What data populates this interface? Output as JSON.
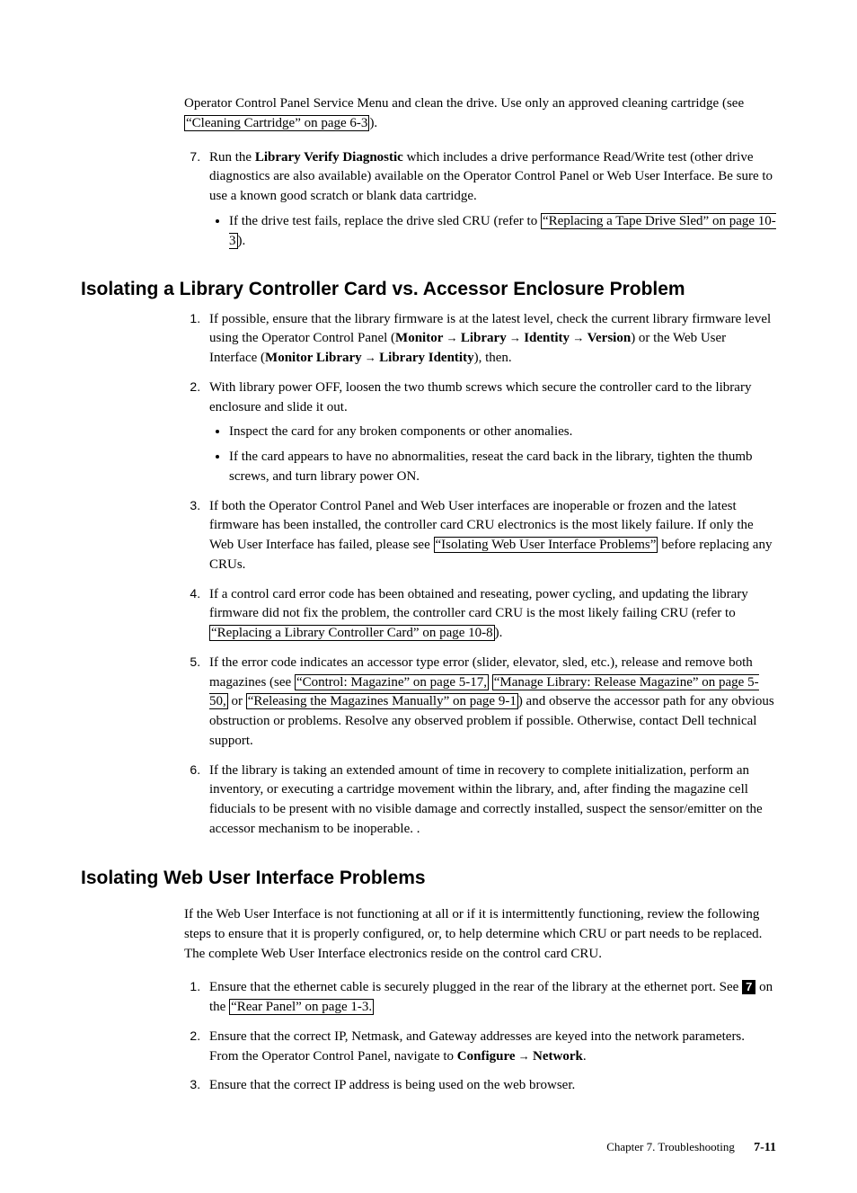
{
  "preamble": {
    "para": "Operator Control Panel Service Menu and clean the drive. Use only an approved cleaning cartridge (see ",
    "link": "“Cleaning Cartridge” on page 6-3",
    "tail": ")."
  },
  "topList": {
    "item7": {
      "run_pre": "Run the ",
      "bold": "Library Verify Diagnostic",
      "run_post": " which includes a drive performance Read/Write test (other drive diagnostics are also available) available on the Operator Control Panel or Web User Interface. Be sure to use a known good scratch or blank data cartridge.",
      "sub_pre": "If the drive test fails, replace the drive sled CRU (refer to ",
      "sub_link": "“Replacing a Tape Drive Sled” on page 10-3",
      "sub_tail": ")."
    }
  },
  "sectionA": {
    "heading": "Isolating a Library Controller Card vs. Accessor Enclosure Problem",
    "i1": {
      "pre": "If possible, ensure that the library firmware is at the latest level, check the current library firmware level using the Operator Control Panel (",
      "b1": "Monitor",
      "arr": " → ",
      "b2": "Library",
      "b3": "Identity",
      "b4": "Version",
      "mid": ") or the Web User Interface (",
      "b5": "Monitor Library",
      "b6": "Library Identity",
      "tail": "), then."
    },
    "i2": {
      "text": "With library power OFF, loosen the two thumb screws which secure the controller card to the library enclosure and slide it out.",
      "s1": "Inspect the card for any broken components or other anomalies.",
      "s2": "If the card appears to have no abnormalities, reseat the card back in the library, tighten the thumb screws, and turn library power ON."
    },
    "i3": {
      "pre": "If both the Operator Control Panel and Web User interfaces are inoperable or frozen and the latest firmware has been installed, the controller card CRU electronics is the most likely failure. If only the Web User Interface has failed, please see ",
      "link": "“Isolating Web User Interface Problems”",
      "tail": " before replacing any CRUs."
    },
    "i4": {
      "pre": "If a control card error code has been obtained and reseating, power cycling, and updating the library firmware did not fix the problem, the controller card CRU is the most likely failing CRU (refer to ",
      "link": "“Replacing a Library Controller Card” on page 10-8",
      "tail": ")."
    },
    "i5": {
      "pre": "If the error code indicates an accessor type error (slider, elevator, sled, etc.), release and remove both magazines (see ",
      "l1": "“Control: Magazine” on page 5-17,",
      "l2": "“Manage Library: Release Magazine” on page 5-50,",
      "mid": " or ",
      "l3": "“Releasing the Magazines Manually” on page 9-1",
      "tail": ") and observe the accessor path for any obvious obstruction or problems. Resolve any observed problem if possible. Otherwise, contact Dell technical support."
    },
    "i6": "If the library is taking an extended amount of time in recovery to complete initialization, perform an inventory, or executing a cartridge movement within the library, and, after finding the magazine cell fiducials to be present with no visible damage and correctly installed, suspect the sensor/emitter on the accessor mechanism to be inoperable. ."
  },
  "sectionB": {
    "heading": "Isolating Web User Interface Problems",
    "intro": "If the Web User Interface is not functioning at all or if it is intermittently functioning, review the following steps to ensure that it is properly configured, or, to help determine which CRU or part needs to be replaced. The complete Web User Interface electronics reside on the control card CRU.",
    "i1": {
      "pre": "Ensure that the ethernet cable is securely plugged in the rear of the library at the ethernet port. See ",
      "num": "7",
      "mid": " on the ",
      "link": "“Rear Panel” on page 1-3.",
      "tail": ""
    },
    "i2": {
      "pre": "Ensure that the correct IP, Netmask, and Gateway addresses are keyed into the network parameters. From the Operator Control Panel, navigate to ",
      "b1": "Configure",
      "arr": " → ",
      "b2": "Network",
      "tail": "."
    },
    "i3": "Ensure that the correct IP address is being used on the web browser."
  },
  "footer": {
    "chapter": "Chapter 7. Troubleshooting",
    "page": "7-11"
  }
}
